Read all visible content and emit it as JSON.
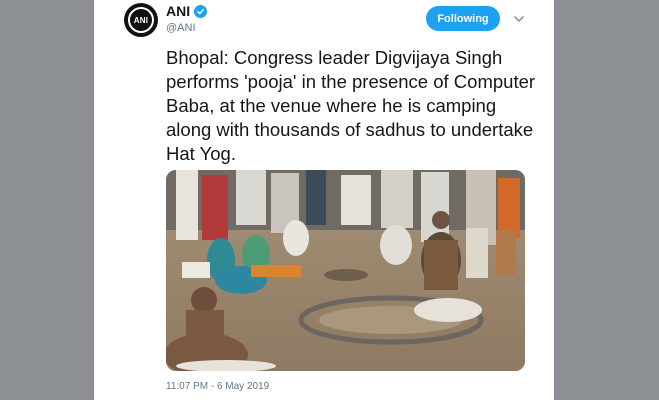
{
  "tweet": {
    "display_name": "ANI",
    "handle": "@ANI",
    "avatar_text": "ANI",
    "follow_label": "Following",
    "text": "Bhopal: Congress leader Digvijaya Singh performs 'pooja' in the presence of Computer Baba, at the venue where he is camping along with thousands of sadhus to undertake Hat Yog.",
    "timestamp": "11:07 PM - 6 May 2019"
  },
  "icons": {
    "verified": "verified-badge-icon",
    "menu": "chevron-down-icon"
  },
  "colors": {
    "accent": "#1da1f2",
    "text": "#14171a",
    "muted": "#657786",
    "backdrop": "#8a8f93"
  }
}
